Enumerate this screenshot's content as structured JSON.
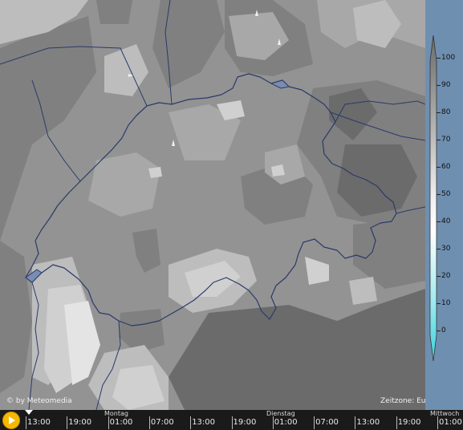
{
  "legend": {
    "ticks": [
      "100",
      "90",
      "80",
      "70",
      "60",
      "50",
      "40",
      "30",
      "20",
      "10",
      "0"
    ],
    "colors": {
      "0": "#3ad2dc",
      "10": "#7ae0e8",
      "20": "#a8ecf0",
      "30": "#cff5f7",
      "40": "#ffffff",
      "50": "#f0f0f0",
      "60": "#d4d4d4",
      "70": "#b8b8b8",
      "80": "#9e9e9e",
      "90": "#858585",
      "100": "#6a6a6a"
    }
  },
  "credit": "© by Meteomedia",
  "timezone": "Zeitzone: Europa/Zurich",
  "timeline": {
    "days": [
      "Montag",
      "Dienstag",
      "Mittwoch"
    ],
    "hours": [
      "13:00",
      "19:00",
      "01:00",
      "07:00",
      "13:00",
      "19:00",
      "01:00",
      "07:00",
      "13:00",
      "19:00",
      "01:00"
    ]
  },
  "map": {
    "palette": {
      "g1": "#6b6b6b",
      "g2": "#808080",
      "g3": "#939393",
      "g4": "#a8a8a8",
      "g5": "#bdbdbd",
      "g6": "#d0d0d0",
      "g7": "#e4e4e4",
      "border": "#2a3a6a"
    }
  }
}
